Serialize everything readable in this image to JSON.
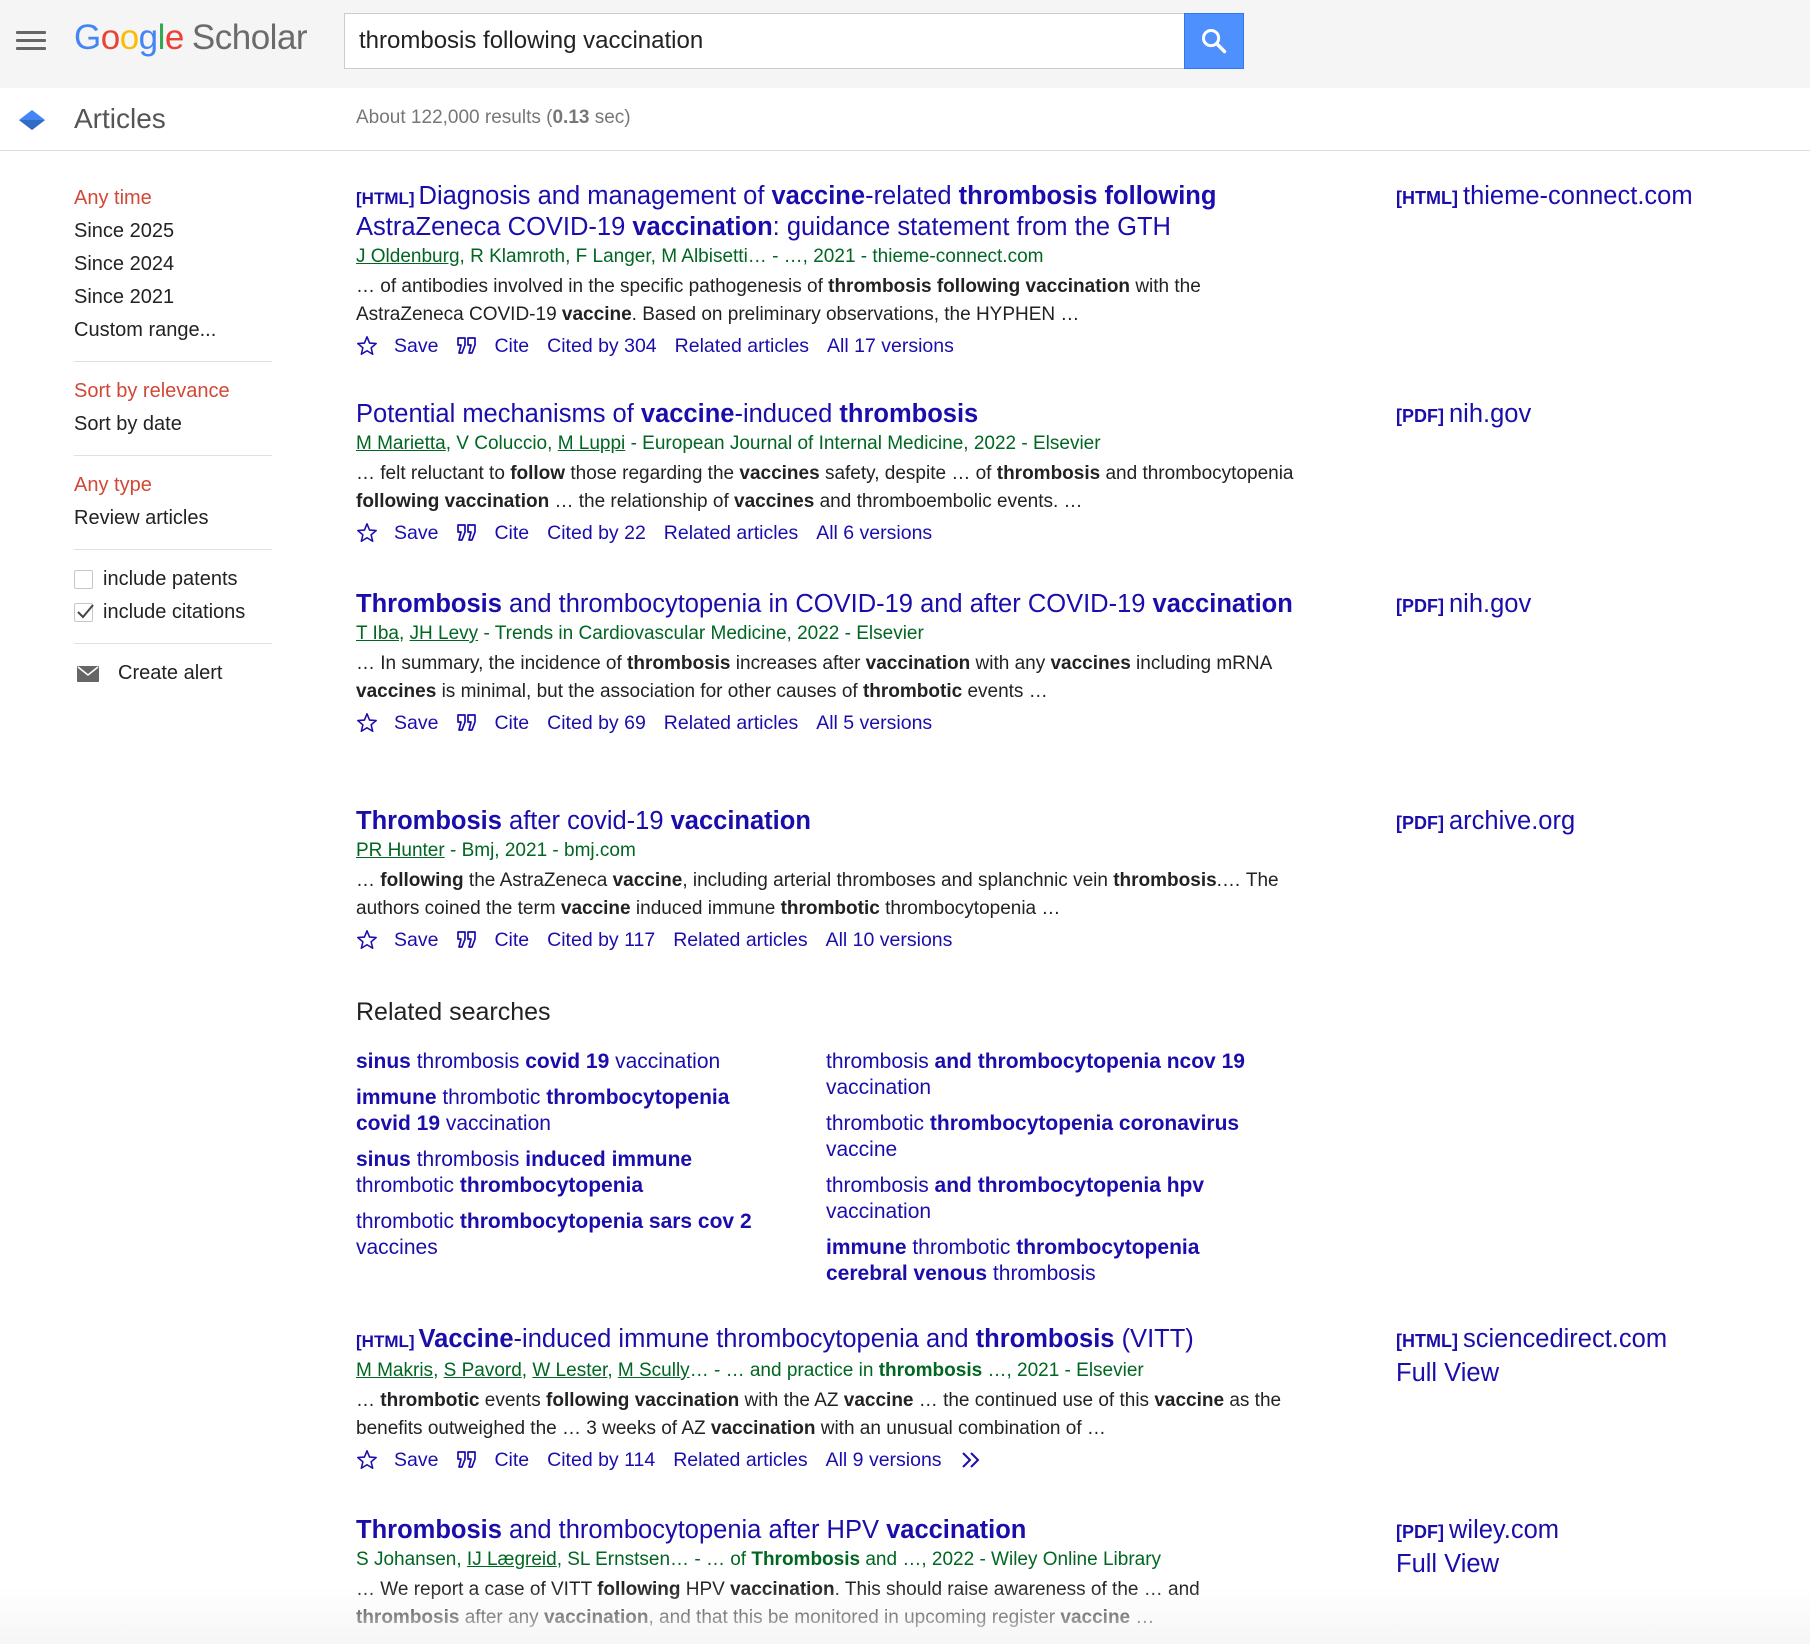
{
  "header": {
    "logo_google": "Google",
    "logo_scholar": "Scholar",
    "search_query": "thrombosis following vaccination"
  },
  "subbar": {
    "section_label": "Articles",
    "stats_prefix": "About 122,000 results (",
    "stats_time": "0.13",
    "stats_suffix": " sec)"
  },
  "sidebar": {
    "time_filters": [
      "Any time",
      "Since 2025",
      "Since 2024",
      "Since 2021",
      "Custom range..."
    ],
    "sort_options": [
      "Sort by relevance",
      "Sort by date"
    ],
    "type_filters": [
      "Any type",
      "Review articles"
    ],
    "include_patents": "include patents",
    "include_citations": "include citations",
    "create_alert": "Create alert"
  },
  "link_labels": {
    "save": "Save",
    "cite": "Cite",
    "related": "Related articles"
  },
  "results": [
    {
      "filetype": "[HTML]",
      "title_segments": [
        [
          "Diagnosis and management of ",
          false
        ],
        [
          "vaccine",
          true
        ],
        [
          "-related ",
          false
        ],
        [
          "thrombosis following",
          true
        ],
        [
          " AstraZeneca COVID-19 ",
          false
        ],
        [
          "vaccination",
          true
        ],
        [
          ": guidance statement from the GTH",
          false
        ]
      ],
      "authors_segments": [
        [
          "J Oldenburg",
          true
        ],
        [
          ", R Klamroth, F Langer, M Albisetti… - …, 2021 - thieme-connect.com",
          false
        ]
      ],
      "snippet_segments": [
        [
          "… of antibodies involved in the specific pathogenesis of ",
          false
        ],
        [
          "thrombosis following vaccination",
          true
        ],
        [
          " with the AstraZeneca COVID-19 ",
          false
        ],
        [
          "vaccine",
          true
        ],
        [
          ". Based on preliminary observations, the HYPHEN …",
          false
        ]
      ],
      "cited_by": "Cited by 304",
      "versions": "All 17 versions",
      "side_type": "[HTML]",
      "side_domain": "thieme-connect.com"
    },
    {
      "filetype": "",
      "title_segments": [
        [
          "Potential mechanisms of ",
          false
        ],
        [
          "vaccine",
          true
        ],
        [
          "-induced ",
          false
        ],
        [
          "thrombosis",
          true
        ]
      ],
      "authors_segments": [
        [
          "M Marietta",
          true
        ],
        [
          ", V Coluccio, ",
          false
        ],
        [
          "M Luppi",
          true
        ],
        [
          " - European Journal of Internal Medicine, 2022 - Elsevier",
          false
        ]
      ],
      "snippet_segments": [
        [
          "… felt reluctant to ",
          false
        ],
        [
          "follow",
          true
        ],
        [
          " those regarding the ",
          false
        ],
        [
          "vaccines",
          true
        ],
        [
          " safety, despite … of ",
          false
        ],
        [
          "thrombosis",
          true
        ],
        [
          " and thrombocytopenia ",
          false
        ],
        [
          "following vaccination",
          true
        ],
        [
          " … the relationship of ",
          false
        ],
        [
          "vaccines",
          true
        ],
        [
          " and thromboembolic events. …",
          false
        ]
      ],
      "cited_by": "Cited by 22",
      "versions": "All 6 versions",
      "side_type": "[PDF]",
      "side_domain": "nih.gov"
    },
    {
      "filetype": "",
      "title_segments": [
        [
          "Thrombosis",
          true
        ],
        [
          " and thrombocytopenia in COVID-19 and after COVID-19 ",
          false
        ],
        [
          "vaccination",
          true
        ]
      ],
      "authors_segments": [
        [
          "T Iba",
          true
        ],
        [
          ", ",
          false
        ],
        [
          "JH Levy",
          true
        ],
        [
          " - Trends in Cardiovascular Medicine, 2022 - Elsevier",
          false
        ]
      ],
      "snippet_segments": [
        [
          "… In summary, the incidence of ",
          false
        ],
        [
          "thrombosis",
          true
        ],
        [
          " increases after ",
          false
        ],
        [
          "vaccination",
          true
        ],
        [
          " with any ",
          false
        ],
        [
          "vaccines",
          true
        ],
        [
          " including mRNA ",
          false
        ],
        [
          "vaccines",
          true
        ],
        [
          " is minimal, but the association for other causes of ",
          false
        ],
        [
          "thrombotic",
          true
        ],
        [
          " events …",
          false
        ]
      ],
      "cited_by": "Cited by 69",
      "versions": "All 5 versions",
      "side_type": "[PDF]",
      "side_domain": "nih.gov"
    },
    {
      "filetype": "",
      "title_segments": [
        [
          "Thrombosis",
          true
        ],
        [
          " after covid-19 ",
          false
        ],
        [
          "vaccination",
          true
        ]
      ],
      "authors_segments": [
        [
          "PR Hunter",
          true
        ],
        [
          " - Bmj, 2021 - bmj.com",
          false
        ]
      ],
      "snippet_segments": [
        [
          "… ",
          false
        ],
        [
          "following",
          true
        ],
        [
          " the AstraZeneca ",
          false
        ],
        [
          "vaccine",
          true
        ],
        [
          ", including arterial thromboses and splanchnic vein ",
          false
        ],
        [
          "thrombosis",
          true
        ],
        [
          ".… The authors coined the term ",
          false
        ],
        [
          "vaccine",
          true
        ],
        [
          " induced immune ",
          false
        ],
        [
          "thrombotic",
          true
        ],
        [
          " thrombocytopenia …",
          false
        ]
      ],
      "cited_by": "Cited by 117",
      "versions": "All 10 versions",
      "side_type": "[PDF]",
      "side_domain": "archive.org"
    },
    {
      "filetype": "[HTML]",
      "title_segments": [
        [
          "Vaccine",
          true
        ],
        [
          "-induced immune thrombocytopenia and ",
          false
        ],
        [
          "thrombosis",
          true
        ],
        [
          " (VITT)",
          false
        ]
      ],
      "authors_segments": [
        [
          "M Makris",
          true
        ],
        [
          ", ",
          false
        ],
        [
          "S Pavord",
          true
        ],
        [
          ", ",
          false
        ],
        [
          "W Lester",
          true
        ],
        [
          ", ",
          false
        ],
        [
          "M Scully",
          true
        ],
        [
          "… - … and practice in ",
          false
        ],
        [
          "thrombosis",
          "bold"
        ],
        [
          " …, 2021 - Elsevier",
          false
        ]
      ],
      "snippet_segments": [
        [
          "… ",
          false
        ],
        [
          "thrombotic",
          true
        ],
        [
          " events ",
          false
        ],
        [
          "following vaccination",
          true
        ],
        [
          " with the AZ ",
          false
        ],
        [
          "vaccine",
          true
        ],
        [
          " … the continued use of this ",
          false
        ],
        [
          "vaccine",
          true
        ],
        [
          " as the benefits outweighed the … 3 weeks of AZ ",
          false
        ],
        [
          "vaccination",
          true
        ],
        [
          " with an unusual combination of …",
          false
        ]
      ],
      "cited_by": "Cited by 114",
      "versions": "All 9 versions",
      "side_type": "[HTML]",
      "side_domain": "sciencedirect.com",
      "full_view": "Full View"
    },
    {
      "filetype": "",
      "title_segments": [
        [
          "Thrombosis",
          true
        ],
        [
          " and thrombocytopenia after HPV ",
          false
        ],
        [
          "vaccination",
          true
        ]
      ],
      "authors_segments": [
        [
          "S Johansen, ",
          false
        ],
        [
          "IJ Lægreid",
          true
        ],
        [
          ", SL Ernstsen… - … of ",
          false
        ],
        [
          "Thrombosis",
          "bold"
        ],
        [
          " and …, 2022 - Wiley Online Library",
          false
        ]
      ],
      "snippet_segments": [
        [
          "… We report a case of VITT ",
          false
        ],
        [
          "following",
          true
        ],
        [
          " HPV ",
          false
        ],
        [
          "vaccination",
          true
        ],
        [
          ". This should raise awareness of the … and ",
          false
        ],
        [
          "thrombosis",
          true
        ],
        [
          " after any ",
          false
        ],
        [
          "vaccination",
          true
        ],
        [
          ", and that this be monitored in upcoming register ",
          false
        ],
        [
          "vaccine",
          true
        ],
        [
          " …",
          false
        ]
      ],
      "cited_by": "",
      "versions": "",
      "side_type": "[PDF]",
      "side_domain": "wiley.com",
      "full_view": "Full View"
    }
  ],
  "related_searches": {
    "title": "Related searches",
    "left": [
      [
        [
          "sinus",
          true
        ],
        [
          " thrombosis ",
          false
        ],
        [
          "covid 19",
          true
        ],
        [
          " vaccination",
          false
        ]
      ],
      [
        [
          "immune",
          true
        ],
        [
          " thrombotic ",
          false
        ],
        [
          "thrombocytopenia covid 19",
          true
        ],
        [
          " vaccination",
          false
        ]
      ],
      [
        [
          "sinus",
          true
        ],
        [
          " thrombosis ",
          false
        ],
        [
          "induced immune",
          true
        ],
        [
          " thrombotic ",
          false
        ],
        [
          "thrombocytopenia",
          true
        ]
      ],
      [
        [
          "thrombotic ",
          false
        ],
        [
          "thrombocytopenia sars cov 2",
          true
        ],
        [
          " vaccines",
          false
        ]
      ]
    ],
    "right": [
      [
        [
          "thrombosis ",
          false
        ],
        [
          "and thrombocytopenia ncov 19",
          true
        ],
        [
          " vaccination",
          false
        ]
      ],
      [
        [
          "thrombotic ",
          false
        ],
        [
          "thrombocytopenia coronavirus",
          true
        ],
        [
          " vaccine",
          false
        ]
      ],
      [
        [
          "thrombosis ",
          false
        ],
        [
          "and thrombocytopenia hpv",
          true
        ],
        [
          " vaccination",
          false
        ]
      ],
      [
        [
          "immune",
          true
        ],
        [
          " thrombotic ",
          false
        ],
        [
          "thrombocytopenia cerebral venous",
          true
        ],
        [
          " thrombosis",
          false
        ]
      ]
    ]
  },
  "colors": {
    "link": "#1a0dab",
    "author_green": "#006621",
    "selected_red": "#d14836",
    "search_button_blue": "#4d90fe"
  }
}
